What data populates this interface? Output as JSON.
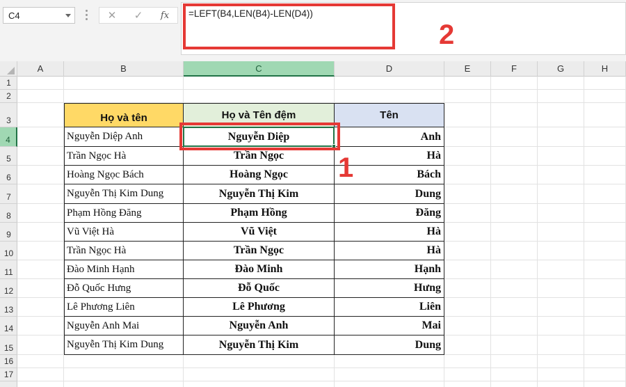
{
  "name_box": {
    "value": "C4"
  },
  "formula_bar": {
    "cancel_symbol": "✕",
    "enter_symbol": "✓",
    "fx_symbol": "fx",
    "formula": "=LEFT(B4,LEN(B4)-LEN(D4))"
  },
  "annotations": {
    "marker_one": "1",
    "marker_two": "2"
  },
  "colors": {
    "header_ho_va_ten": "#ffd966",
    "header_ho_va_ten_dem": "#e2efda",
    "header_ten": "#d9e1f2",
    "annotation_red": "#e53935",
    "selection_green": "#217346"
  },
  "grid": {
    "columns": [
      "A",
      "B",
      "C",
      "D",
      "E",
      "F",
      "G",
      "H"
    ],
    "rows": [
      "1",
      "2",
      "3",
      "4",
      "5",
      "6",
      "7",
      "8",
      "9",
      "10",
      "11",
      "12",
      "13",
      "14",
      "15",
      "16",
      "17"
    ],
    "active_column": "C",
    "active_row": "4"
  },
  "table": {
    "headers": {
      "full_name": "Họ và tên",
      "last_middle": "Họ và Tên đệm",
      "first_name": "Tên"
    },
    "rows": [
      {
        "full_name": "Nguyễn Diệp Anh",
        "last_middle": "Nguyễn Diệp",
        "first_name": "Anh"
      },
      {
        "full_name": "Trần Ngọc Hà",
        "last_middle": "Trần Ngọc",
        "first_name": "Hà"
      },
      {
        "full_name": "Hoàng Ngọc Bách",
        "last_middle": "Hoàng Ngọc",
        "first_name": "Bách"
      },
      {
        "full_name": "Nguyễn Thị Kim Dung",
        "last_middle": "Nguyễn Thị Kim",
        "first_name": "Dung"
      },
      {
        "full_name": "Phạm Hồng Đăng",
        "last_middle": "Phạm Hồng",
        "first_name": "Đăng"
      },
      {
        "full_name": "Vũ Việt Hà",
        "last_middle": "Vũ Việt",
        "first_name": "Hà"
      },
      {
        "full_name": "Trần Ngọc Hà",
        "last_middle": "Trần Ngọc",
        "first_name": "Hà"
      },
      {
        "full_name": "Đào Minh Hạnh",
        "last_middle": "Đào Minh",
        "first_name": "Hạnh"
      },
      {
        "full_name": "Đỗ Quốc Hưng",
        "last_middle": "Đỗ Quốc",
        "first_name": "Hưng"
      },
      {
        "full_name": "Lê Phương Liên",
        "last_middle": "Lê Phương",
        "first_name": "Liên"
      },
      {
        "full_name": "Nguyễn Anh Mai",
        "last_middle": "Nguyễn Anh",
        "first_name": "Mai"
      },
      {
        "full_name": "Nguyễn Thị Kim Dung",
        "last_middle": "Nguyễn Thị Kim",
        "first_name": "Dung"
      }
    ]
  }
}
